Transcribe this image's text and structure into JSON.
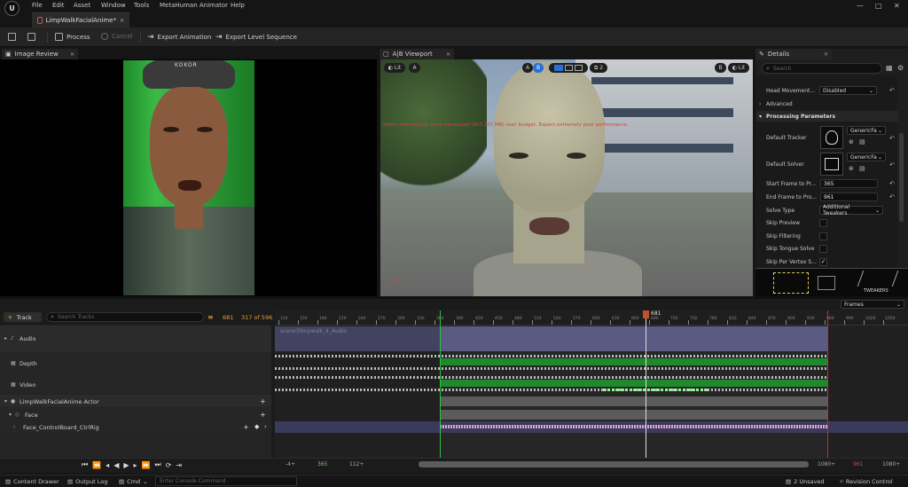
{
  "menu": {
    "logo": "U",
    "items": [
      "File",
      "Edit",
      "Asset",
      "Window",
      "Tools",
      "MetaHuman Animator",
      "Help"
    ]
  },
  "window_controls": {
    "minimize": "—",
    "maximize": "□",
    "close": "✕"
  },
  "document_tab": {
    "title": "LimpWalkFacialAnime*",
    "close": "✕"
  },
  "toolbar": {
    "process": "Process",
    "cancel": "Cancel",
    "export_animation": "Export Animation",
    "export_level_sequence": "Export Level Sequence"
  },
  "image_review": {
    "tab_label": "Image Review",
    "cap_text": "KOKOR"
  },
  "viewport": {
    "tab_label": "A|B Viewport",
    "lit_left": "Lit",
    "a_left": "A",
    "a_center": "A",
    "b_center": "B",
    "split_count": "2",
    "b_right": "B",
    "lit_right": "Lit",
    "warning": "Video memory has been exhausted (927.207 MB) over budget. Expect extremely poor performance."
  },
  "details": {
    "tab_label": "Details",
    "search_placeholder": "Search",
    "head_movement_label": "Head Movement...",
    "head_movement_value": "Disabled",
    "advanced_label": "Advanced",
    "processing_parameters_label": "Processing Parameters",
    "default_tracker_label": "Default Tracker",
    "default_tracker_value": "GenericFa",
    "default_solver_label": "Default Solver",
    "default_solver_value": "GenericFa",
    "start_frame_label": "Start Frame to Pr...",
    "start_frame_value": "365",
    "end_frame_label": "End Frame to Pro...",
    "end_frame_value": "961",
    "solve_type_label": "Solve Type",
    "solve_type_value": "Additional Tweakers",
    "skip_preview_label": "Skip Preview",
    "skip_filtering_label": "Skip Filtering",
    "skip_tongue_solve_label": "Skip Tongue Solve",
    "skip_per_vertex_label": "Skip Per Vertex S...",
    "skip_per_vertex_checked": true,
    "tweakers_label": "TWEAKERS"
  },
  "sequencer": {
    "add_track_label": "Track",
    "search_placeholder": "Search Tracks",
    "current_frame": "681",
    "frame_count": "317 of 596",
    "time_display_mode": "Frames",
    "playhead_label": "681",
    "ruler_labels": [
      "120",
      "150",
      "180",
      "210",
      "240",
      "270",
      "300",
      "330",
      "360",
      "390",
      "420",
      "450",
      "480",
      "510",
      "540",
      "570",
      "600",
      "630",
      "660",
      "690",
      "720",
      "750",
      "780",
      "810",
      "840",
      "870",
      "900",
      "930",
      "960",
      "990",
      "1020",
      "1050"
    ],
    "tracks": [
      {
        "label": "Audio"
      },
      {
        "label": "Depth"
      },
      {
        "label": "Video"
      },
      {
        "label": "LimpWalkFacialAnime Actor"
      },
      {
        "label": "Face"
      },
      {
        "label": "Face_ControlBoard_CtrlRig"
      }
    ],
    "audio_clip_label": "scene3limpwalk_4_Audio",
    "view_start": "-4+",
    "play_start": "365",
    "view_in": "112+",
    "view_out": "1080+",
    "play_end": "961",
    "view_end": "1080+"
  },
  "statusbar": {
    "content_drawer": "Content Drawer",
    "output_log": "Output Log",
    "cmd": "Cmd",
    "console_placeholder": "Enter Console Command",
    "unsaved": "2 Unsaved",
    "revision_control": "Revision Control"
  },
  "colors": {
    "accent_blue": "#2a6fd8",
    "warning_red": "#e23a3a",
    "play_range_green": "#1f8a2c",
    "audio_lane": "#5a5a82",
    "playhead_orange": "#c0502a"
  }
}
